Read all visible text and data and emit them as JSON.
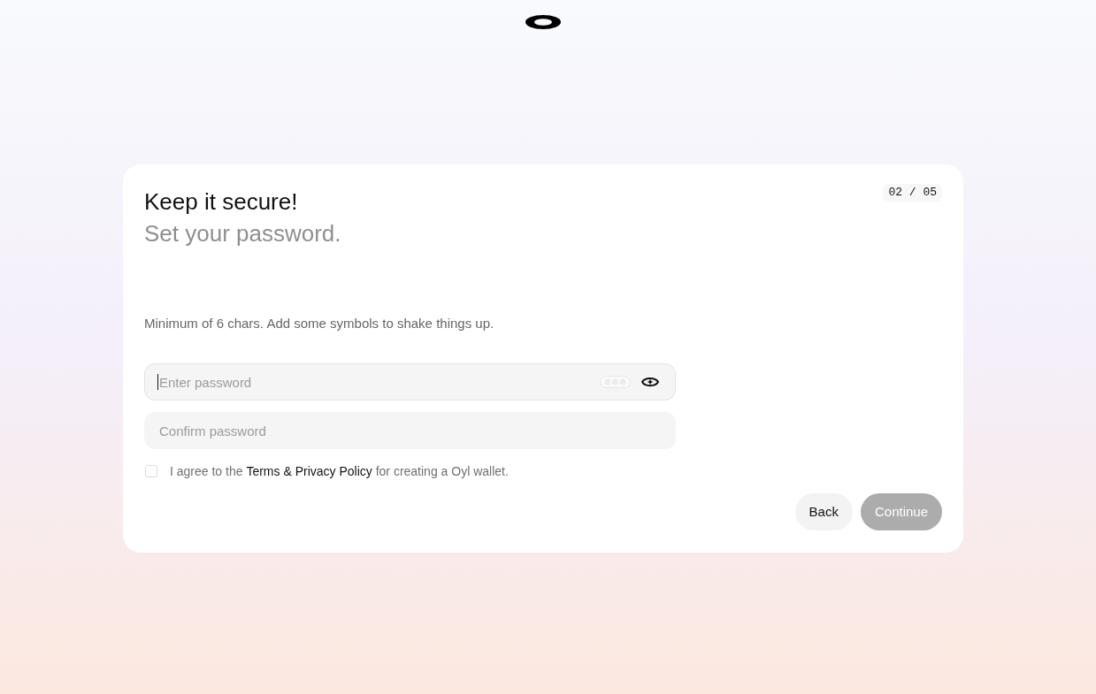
{
  "step": "02 / 05",
  "heading": "Keep it secure!",
  "subheading": "Set your password.",
  "hint": "Minimum of 6 chars. Add some symbols to shake things up.",
  "fields": [
    {
      "kind": "password",
      "placeholder": "Enter password",
      "focused": true
    },
    {
      "kind": "confirm",
      "placeholder": "Confirm password",
      "focused": false
    }
  ],
  "agreement": {
    "checked": false,
    "before": "I agree to the",
    "link": "Terms & Privacy Policy",
    "after": "for creating a Oyl wallet."
  },
  "buttons": [
    {
      "label": "Back",
      "kind": "secondary",
      "disabled": false
    },
    {
      "label": "Continue",
      "kind": "primary",
      "disabled": true
    }
  ]
}
